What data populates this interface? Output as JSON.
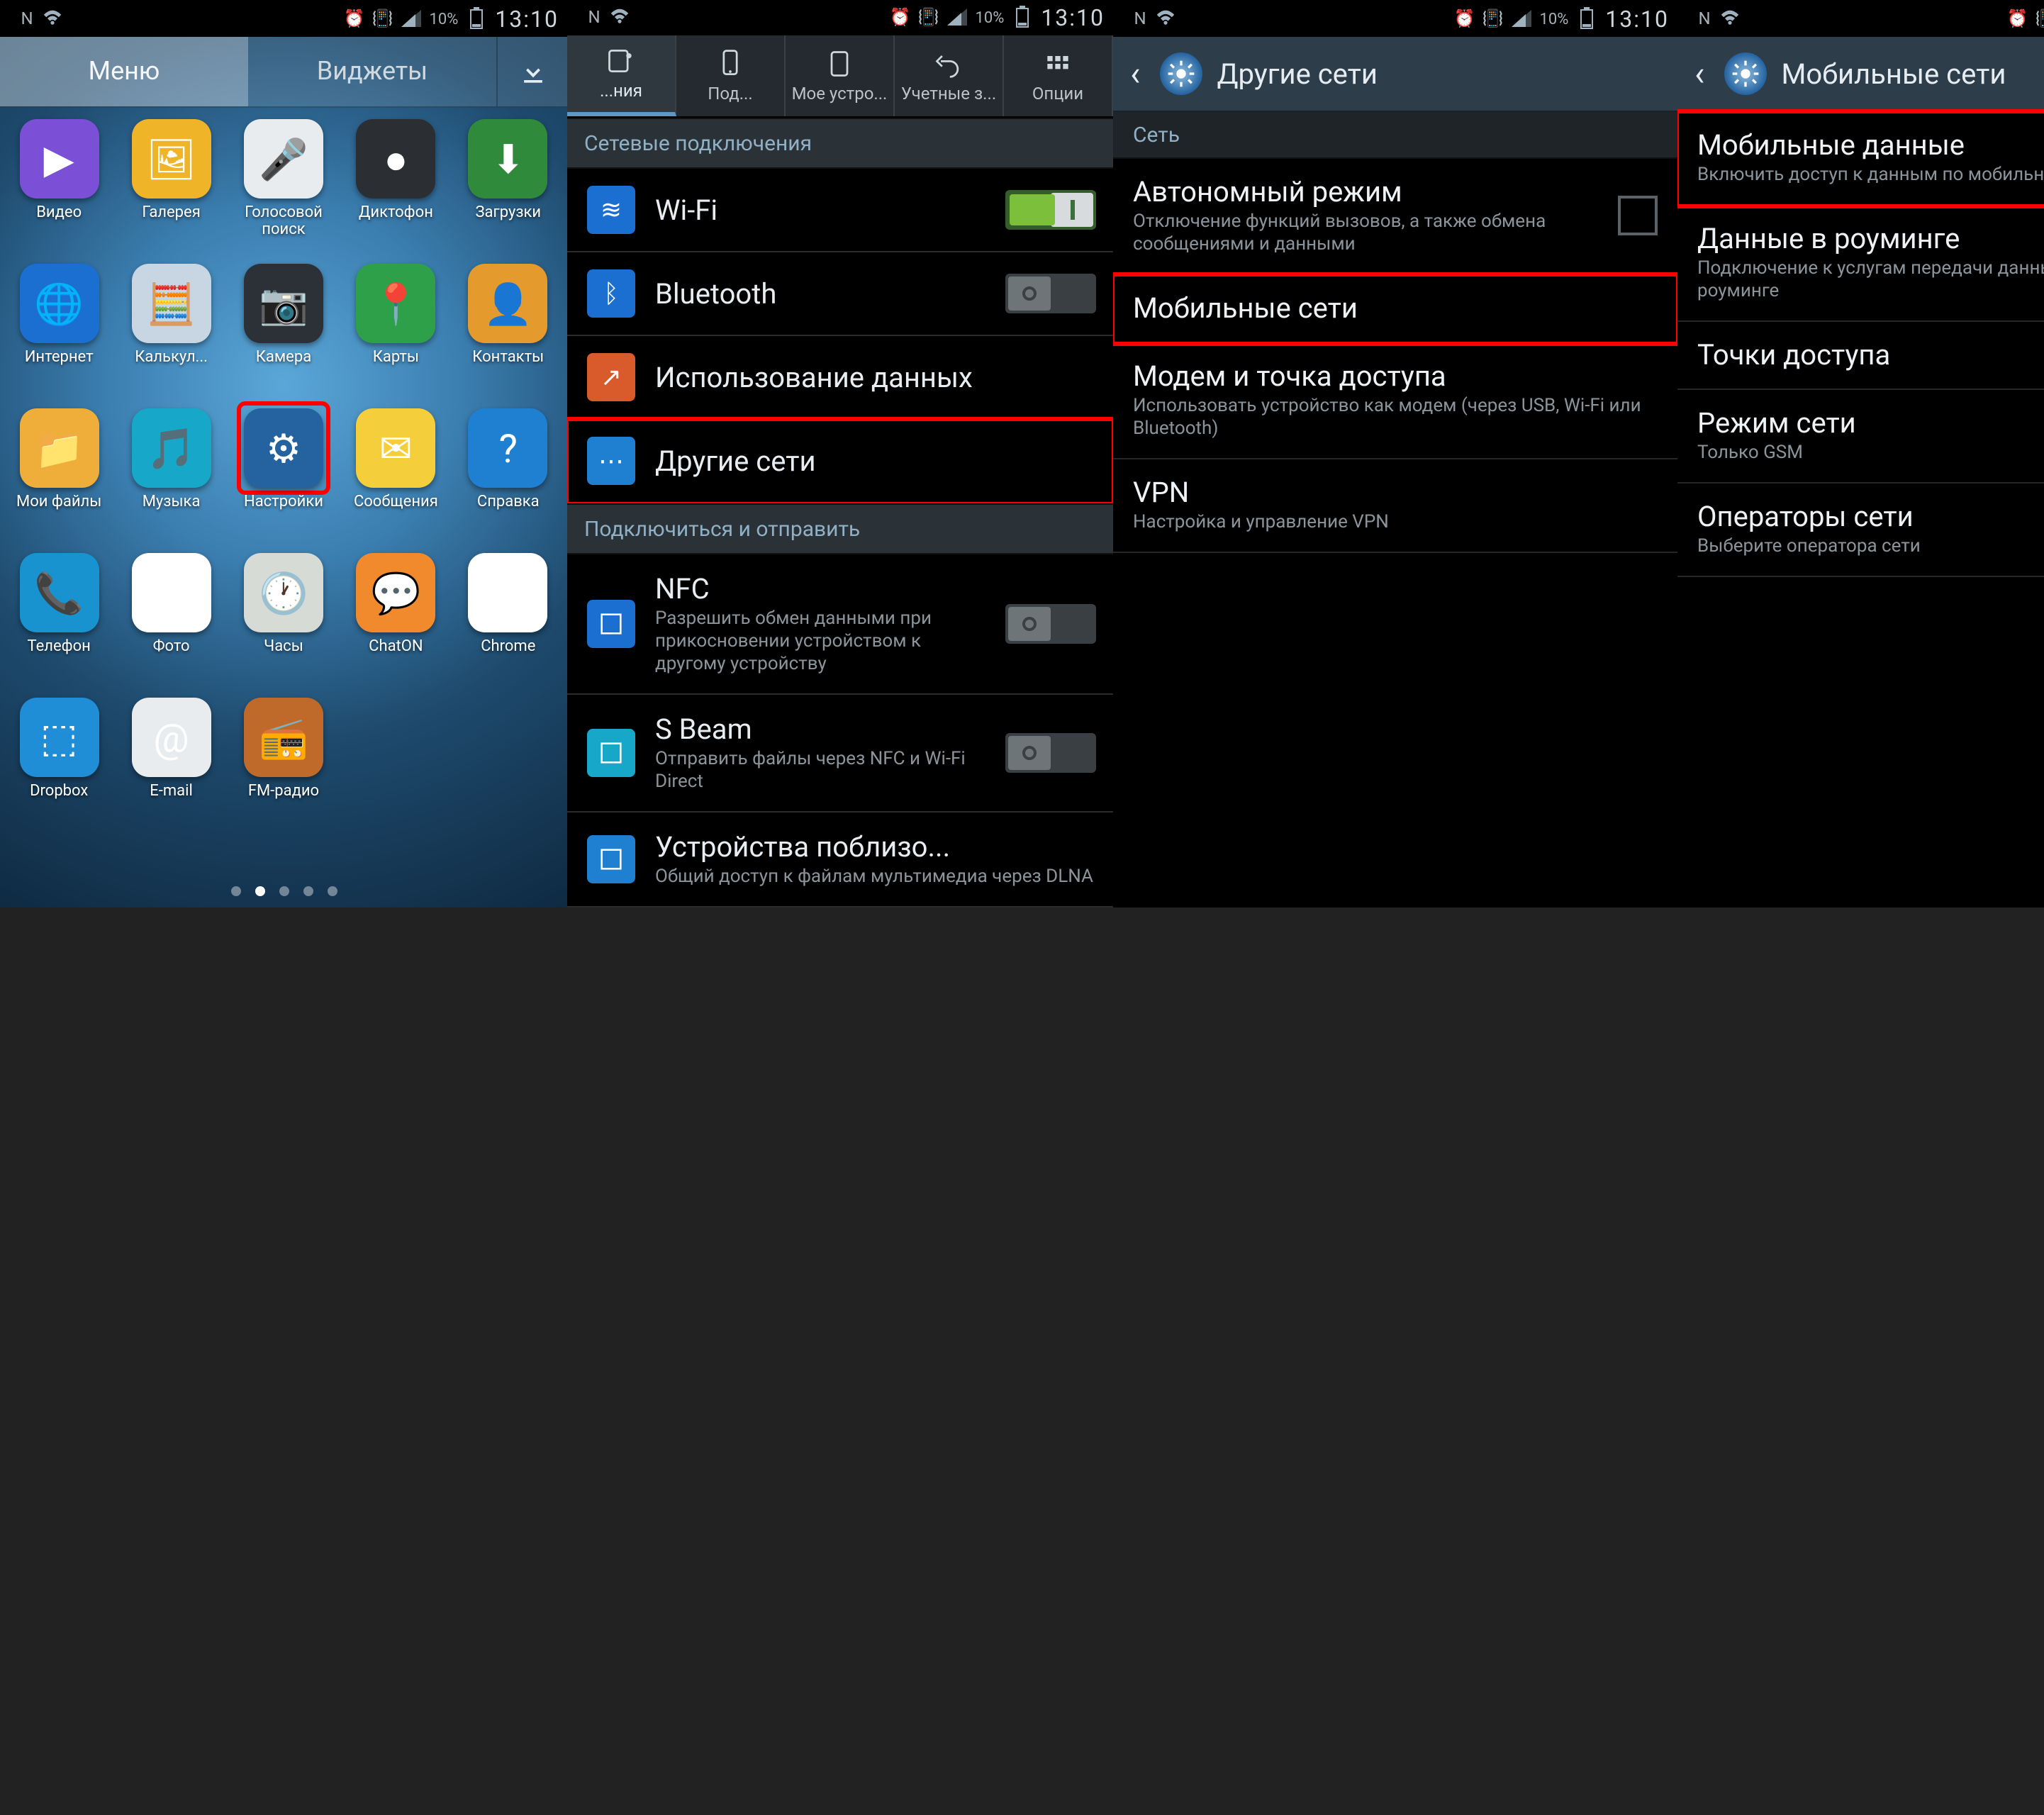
{
  "statusbar": {
    "battery_pct": "10%",
    "time": "13:10"
  },
  "screen1": {
    "tabs": {
      "menu": "Меню",
      "widgets": "Виджеты"
    },
    "apps": [
      {
        "name": "video",
        "label": "Видео",
        "glyph": "▶",
        "bg": "#7b4fd6"
      },
      {
        "name": "gallery",
        "label": "Галерея",
        "glyph": "🖼",
        "bg": "#f0b428"
      },
      {
        "name": "voice",
        "label": "Голосовой\nпоиск",
        "glyph": "🎤",
        "bg": "#e8ecef"
      },
      {
        "name": "recorder",
        "label": "Диктофон",
        "glyph": "●",
        "bg": "#2b2f33"
      },
      {
        "name": "downloads",
        "label": "Загрузки",
        "glyph": "⬇",
        "bg": "#2f8b3b"
      },
      {
        "name": "internet",
        "label": "Интернет",
        "glyph": "🌐",
        "bg": "#1a6fd0"
      },
      {
        "name": "calc",
        "label": "Калькул...",
        "glyph": "🧮",
        "bg": "#c7d6e2"
      },
      {
        "name": "camera",
        "label": "Камера",
        "glyph": "📷",
        "bg": "#2b3136"
      },
      {
        "name": "maps",
        "label": "Карты",
        "glyph": "📍",
        "bg": "#2fa04a"
      },
      {
        "name": "contacts",
        "label": "Контакты",
        "glyph": "👤",
        "bg": "#e59a2e"
      },
      {
        "name": "files",
        "label": "Мои файлы",
        "glyph": "📁",
        "bg": "#efae3a"
      },
      {
        "name": "music",
        "label": "Музыка",
        "glyph": "🎵",
        "bg": "#17a7c9"
      },
      {
        "name": "settings",
        "label": "Настройки",
        "glyph": "⚙",
        "bg": "#2463a0",
        "highlight": true
      },
      {
        "name": "messages",
        "label": "Сообщения",
        "glyph": "✉",
        "bg": "#f4cf3b"
      },
      {
        "name": "help",
        "label": "Справка",
        "glyph": "?",
        "bg": "#1f7fd1"
      },
      {
        "name": "phone",
        "label": "Телефон",
        "glyph": "📞",
        "bg": "#1893cf"
      },
      {
        "name": "photos",
        "label": "Фото",
        "glyph": "✦",
        "bg": "#ffffff"
      },
      {
        "name": "clock",
        "label": "Часы",
        "glyph": "🕐",
        "bg": "#d7dbd6"
      },
      {
        "name": "chaton",
        "label": "ChatON",
        "glyph": "💬",
        "bg": "#f08a2d"
      },
      {
        "name": "chrome",
        "label": "Chrome",
        "glyph": "◉",
        "bg": "#ffffff"
      },
      {
        "name": "dropbox",
        "label": "Dropbox",
        "glyph": "⬚",
        "bg": "#1f8ed6"
      },
      {
        "name": "email",
        "label": "E-mail",
        "glyph": "@",
        "bg": "#e8ecef"
      },
      {
        "name": "fmradio",
        "label": "FM-радио",
        "glyph": "📻",
        "bg": "#bf6a2a"
      }
    ]
  },
  "screen2": {
    "tabs": [
      {
        "name": "connections",
        "label": "...ния"
      },
      {
        "name": "my-device",
        "label": "Под..."
      },
      {
        "name": "device",
        "label": "Мое устро..."
      },
      {
        "name": "accounts",
        "label": "Учетные з..."
      },
      {
        "name": "options",
        "label": "Опции"
      }
    ],
    "section1": "Сетевые подключения",
    "rows1": [
      {
        "name": "wifi",
        "title": "Wi-Fi",
        "toggle": "on",
        "icon_bg": "#1a6fd0",
        "glyph": "≋"
      },
      {
        "name": "bluetooth",
        "title": "Bluetooth",
        "toggle": "off",
        "icon_bg": "#1a6fd0",
        "glyph": "ᛒ"
      },
      {
        "name": "data",
        "title": "Использование данных",
        "icon_bg": "#d95a2b",
        "glyph": "↗"
      },
      {
        "name": "other",
        "title": "Другие сети",
        "icon_bg": "#1f7fd1",
        "glyph": "⋯",
        "highlight": true
      }
    ],
    "section2": "Подключиться и отправить",
    "rows2": [
      {
        "name": "nfc",
        "title": "NFC",
        "sub": "Разрешить обмен данными при прикосновении устройством к другому устройству",
        "toggle": "off",
        "icon_bg": "#1a6fd0"
      },
      {
        "name": "sbeam",
        "title": "S Beam",
        "sub": "Отправить файлы через NFC и Wi-Fi Direct",
        "toggle": "off",
        "icon_bg": "#17a7c9"
      },
      {
        "name": "nearby",
        "title": "Устройства поблизо...",
        "sub": "Общий доступ к файлам мультимедиа через DLNA",
        "icon_bg": "#1f7fd1"
      }
    ]
  },
  "screen3": {
    "title": "Другие сети",
    "section": "Сеть",
    "rows": [
      {
        "name": "airplane",
        "title": "Автономный режим",
        "sub": "Отключение функций вызовов, а также обмена сообщениями и данными",
        "checkbox": "unchecked"
      },
      {
        "name": "mobile",
        "title": "Мобильные сети",
        "highlight": true
      },
      {
        "name": "tether",
        "title": "Модем и точка доступа",
        "sub": "Использовать устройство как модем (через USB, Wi-Fi или Bluetooth)"
      },
      {
        "name": "vpn",
        "title": "VPN",
        "sub": "Настройка и управление VPN"
      }
    ]
  },
  "screen4": {
    "title": "Мобильные сети",
    "rows": [
      {
        "name": "mobiledata",
        "title": "Мобильные данные",
        "sub": "Включить доступ к данным по мобильной сети",
        "checkbox": "checked",
        "highlight": true
      },
      {
        "name": "roaming",
        "title": "Данные в роуминге",
        "sub": "Подключение к услугам передачи данных в роуминге",
        "checkbox": "unchecked"
      },
      {
        "name": "apn",
        "title": "Точки доступа"
      },
      {
        "name": "netmode",
        "title": "Режим сети",
        "sub": "Только GSM",
        "chevron": true
      },
      {
        "name": "operators",
        "title": "Операторы сети",
        "sub": "Выберите оператора сети"
      }
    ]
  }
}
